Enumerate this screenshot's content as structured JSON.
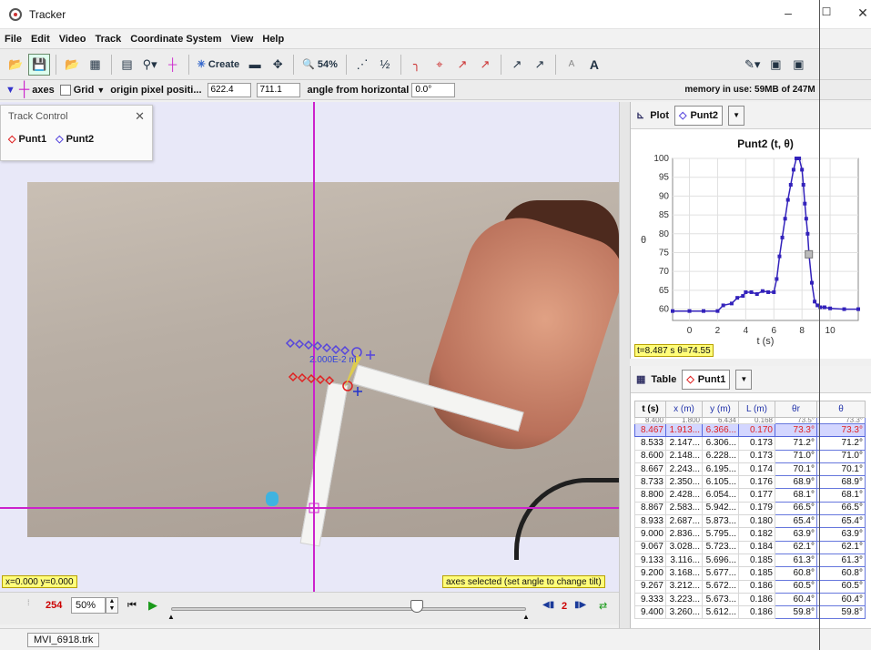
{
  "window": {
    "title": "Tracker",
    "minimize": "–",
    "maximize": "☐",
    "close": "✕"
  },
  "menu": [
    "File",
    "Edit",
    "Video",
    "Track",
    "Coordinate System",
    "View",
    "Help"
  ],
  "toolbar": {
    "create_label": "Create",
    "zoom_label": "54%",
    "font_small": "A",
    "font_large": "A"
  },
  "axesbar": {
    "axes_label": "axes",
    "grid_label": "Grid",
    "origin_label": "origin pixel positi...",
    "origin_x": "622.4",
    "origin_y": "711.1",
    "angle_label": "angle from horizontal",
    "angle_value": "0.0°",
    "memory": "memory in use: 59MB of 247M"
  },
  "track_control": {
    "title": "Track Control",
    "tracks": [
      "Punt1",
      "Punt2"
    ]
  },
  "video": {
    "scale_label": "2.000E-2 m",
    "coord_readout": "x=0.000  y=0.000",
    "axes_message": "axes selected (set angle to change tilt)"
  },
  "player": {
    "frame": "254",
    "zoom": "50%",
    "step": "2"
  },
  "status": {
    "file_tab": "MVI_6918.trk"
  },
  "plot": {
    "panel_label": "Plot",
    "track": "Punt2",
    "readout": "t=8.487 s  θ=74.55",
    "chart_data": {
      "type": "line",
      "title": "Punt2 (t, θ)",
      "xlabel": "t (s)",
      "ylabel": "θ",
      "xlim": [
        -1.2,
        12
      ],
      "ylim": [
        57,
        100
      ],
      "xticks": [
        0,
        2,
        4,
        6,
        8,
        10
      ],
      "yticks": [
        60,
        65,
        70,
        75,
        80,
        85,
        90,
        95,
        100
      ],
      "grid": true,
      "series": [
        {
          "x": [
            -1.2,
            0,
            1,
            2,
            2.4,
            3,
            3.4,
            3.8,
            4,
            4.4,
            4.8,
            5.2,
            5.6,
            6,
            6.2,
            6.4,
            6.6,
            6.8,
            7,
            7.2,
            7.4,
            7.6,
            7.8,
            8,
            8.1,
            8.2,
            8.3,
            8.4,
            8.5,
            8.7,
            8.9,
            9.1,
            9.3,
            9.6,
            10,
            11,
            12
          ],
          "y": [
            59.5,
            59.5,
            59.5,
            59.5,
            61,
            61.5,
            63,
            63.5,
            64.5,
            64.5,
            64,
            64.8,
            64.5,
            64.5,
            68,
            74,
            79,
            84,
            89,
            93,
            97,
            100,
            100,
            97,
            93,
            88,
            84,
            80,
            74.5,
            67,
            62,
            61,
            60.5,
            60.5,
            60.2,
            60,
            60
          ]
        }
      ],
      "highlight": {
        "x": 8.487,
        "y": 74.55
      }
    }
  },
  "table": {
    "panel_label": "Table",
    "track": "Punt1",
    "columns": [
      "t (s)",
      "x (m)",
      "y (m)",
      "L (m)",
      "θr",
      "θ"
    ],
    "top_partial": [
      "8.400",
      "1.800",
      "6.434",
      "0.168",
      "73.5°",
      "73.3°"
    ],
    "rows": [
      [
        "8.467",
        "1.913...",
        "6.366...",
        "0.170",
        "73.3°",
        "73.3°"
      ],
      [
        "8.533",
        "2.147...",
        "6.306...",
        "0.173",
        "71.2°",
        "71.2°"
      ],
      [
        "8.600",
        "2.148...",
        "6.228...",
        "0.173",
        "71.0°",
        "71.0°"
      ],
      [
        "8.667",
        "2.243...",
        "6.195...",
        "0.174",
        "70.1°",
        "70.1°"
      ],
      [
        "8.733",
        "2.350...",
        "6.105...",
        "0.176",
        "68.9°",
        "68.9°"
      ],
      [
        "8.800",
        "2.428...",
        "6.054...",
        "0.177",
        "68.1°",
        "68.1°"
      ],
      [
        "8.867",
        "2.583...",
        "5.942...",
        "0.179",
        "66.5°",
        "66.5°"
      ],
      [
        "8.933",
        "2.687...",
        "5.873...",
        "0.180",
        "65.4°",
        "65.4°"
      ],
      [
        "9.000",
        "2.836...",
        "5.795...",
        "0.182",
        "63.9°",
        "63.9°"
      ],
      [
        "9.067",
        "3.028...",
        "5.723...",
        "0.184",
        "62.1°",
        "62.1°"
      ],
      [
        "9.133",
        "3.116...",
        "5.696...",
        "0.185",
        "61.3°",
        "61.3°"
      ],
      [
        "9.200",
        "3.168...",
        "5.677...",
        "0.185",
        "60.8°",
        "60.8°"
      ],
      [
        "9.267",
        "3.212...",
        "5.672...",
        "0.186",
        "60.5°",
        "60.5°"
      ],
      [
        "9.333",
        "3.223...",
        "5.673...",
        "0.186",
        "60.4°",
        "60.4°"
      ],
      [
        "9.400",
        "3.260...",
        "5.612...",
        "0.186",
        "59.8°",
        "59.8°"
      ]
    ]
  },
  "colors": {
    "accent_magenta": "#cc22cc",
    "punt1": "#e02020",
    "punt2": "#5544dd",
    "highlight": "#fffd7a"
  }
}
